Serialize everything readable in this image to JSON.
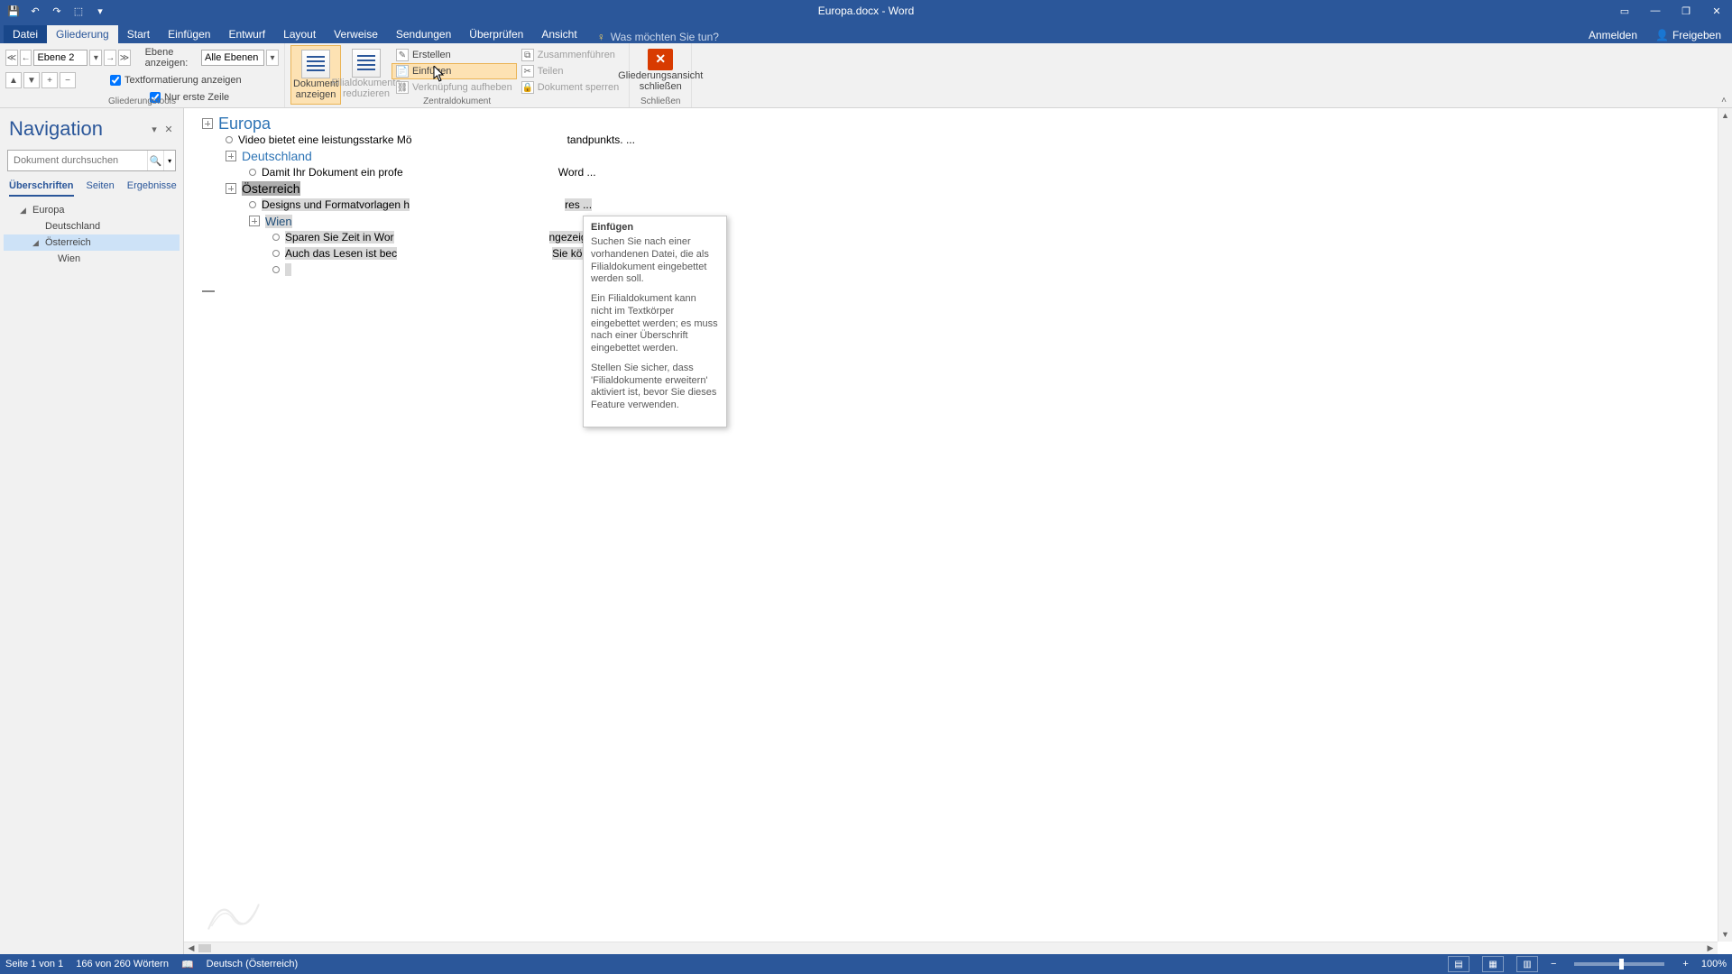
{
  "app": {
    "title": "Europa.docx - Word"
  },
  "tabs": {
    "file": "Datei",
    "outlining": "Gliederung",
    "home": "Start",
    "insert": "Einfügen",
    "design": "Entwurf",
    "layout": "Layout",
    "references": "Verweise",
    "mailings": "Sendungen",
    "review": "Überprüfen",
    "view": "Ansicht",
    "tellme": "Was möchten Sie tun?",
    "signin": "Anmelden",
    "share": "Freigeben"
  },
  "ribbon": {
    "group1_label": "Gliederungstools",
    "level_value": "Ebene 2",
    "show_level_label": "Ebene anzeigen:",
    "show_level_value": "Alle Ebenen",
    "show_formatting": "Textformatierung anzeigen",
    "first_line_only": "Nur erste Zeile",
    "show_doc": "Dokument anzeigen",
    "collapse_sub": "Filialdokumente reduzieren",
    "create": "Erstellen",
    "insert": "Einfügen",
    "unlink": "Verknüpfung aufheben",
    "merge": "Zusammenführen",
    "split": "Teilen",
    "lock": "Dokument sperren",
    "group2_label": "Zentraldokument",
    "close_outline": "Gliederungsansicht schließen",
    "group3_label": "Schließen"
  },
  "tooltip": {
    "title": "Einfügen",
    "p1": "Suchen Sie nach einer vorhandenen Datei, die als Filialdokument eingebettet werden soll.",
    "p2": "Ein Filialdokument kann nicht im Textkörper eingebettet werden; es muss nach einer Überschrift eingebettet werden.",
    "p3": "Stellen Sie sicher, dass 'Filialdokumente erweitern' aktiviert ist, bevor Sie dieses Feature verwenden."
  },
  "nav": {
    "title": "Navigation",
    "search_placeholder": "Dokument durchsuchen",
    "tab_headings": "Überschriften",
    "tab_pages": "Seiten",
    "tab_results": "Ergebnisse",
    "tree": {
      "n1": "Europa",
      "n2": "Deutschland",
      "n3": "Österreich",
      "n4": "Wien"
    }
  },
  "outline": {
    "l1": "Europa",
    "l1b": "Video bietet eine leistungsstarke Mö",
    "l1b_tail": "tandpunkts. ...",
    "l2": "Deutschland",
    "l2b": "Damit Ihr Dokument ein profe",
    "l2b_tail": "Word ...",
    "l3": "Österreich",
    "l3b": "Designs und Formatvorlagen h",
    "l3b_tail": "res ...",
    "l4": "Wien",
    "l4b": "Sparen Sie Zeit in Wor",
    "l4b_tail": "ngezeigt ...",
    "l4c": "Auch das Lesen ist bec",
    "l4c_tail": "Sie können ..."
  },
  "status": {
    "page": "Seite 1 von 1",
    "words": "166 von 260 Wörtern",
    "lang": "Deutsch (Österreich)",
    "zoom": "100%"
  }
}
